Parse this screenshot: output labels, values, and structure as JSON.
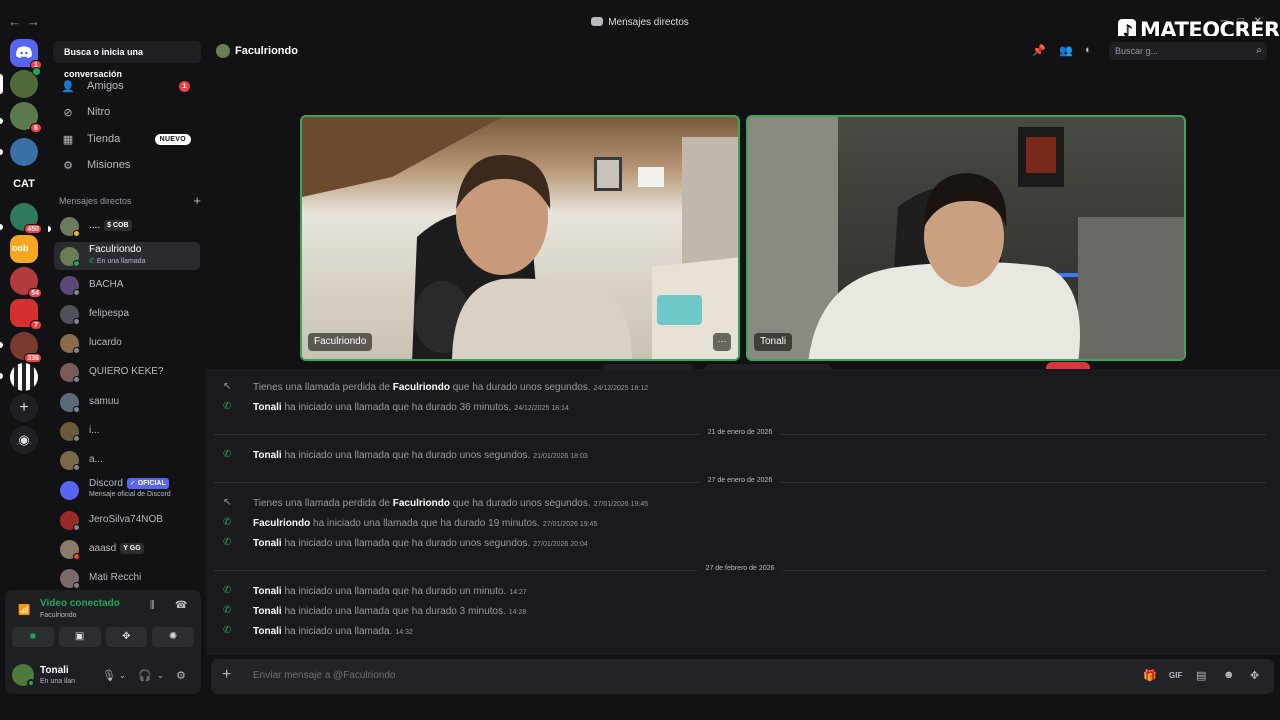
{
  "window": {
    "title": "Mensajes directos",
    "watermark": "MATEOCRERR"
  },
  "servers": {
    "badges": [
      "1",
      "6",
      "450",
      "54",
      "7",
      "336"
    ],
    "cat_label": "CAT"
  },
  "sidebar": {
    "search_label": "Busca o inicia una conversación",
    "nav": [
      {
        "label": "Amigos",
        "icon": "friends-icon",
        "count": "1"
      },
      {
        "label": "Nitro",
        "icon": "nitro-icon"
      },
      {
        "label": "Tienda",
        "icon": "shop-icon",
        "badge": "NUEVO"
      },
      {
        "label": "Misiones",
        "icon": "quests-icon"
      }
    ],
    "dm_header": "Mensajes directos",
    "dms": [
      {
        "name": "....",
        "tag": "COB"
      },
      {
        "name": "Faculriondo",
        "sub": "En una llamada"
      },
      {
        "name": "BACHA"
      },
      {
        "name": "felipespa"
      },
      {
        "name": "lucardo"
      },
      {
        "name": "QUIERO KEKE?"
      },
      {
        "name": "samuu"
      },
      {
        "name": "i..."
      },
      {
        "name": "a..."
      },
      {
        "name": "Discord",
        "tag": "OFICIAL",
        "sub": "Mensaje oficial de Discord"
      },
      {
        "name": "JeroSilva74NOB"
      },
      {
        "name": "aaasd",
        "tag": "GG"
      },
      {
        "name": "Mati Recchi"
      }
    ]
  },
  "voice": {
    "status": "Video conectado",
    "channel": "Faculriondo"
  },
  "user": {
    "name": "Tonali",
    "status": "En una llan"
  },
  "chat": {
    "recipient": "Faculriondo",
    "search_placeholder": "Buscar g...",
    "tiles": [
      "Faculriondo",
      "Tonali"
    ],
    "composer_placeholder": "Enviar mensaje a @Faculriondo",
    "log": [
      {
        "kind": "missed",
        "pre": "Tienes una llamada perdida de ",
        "who": "Faculriondo",
        "post": " que ha durado unos segundos.",
        "ts": "24/12/2025 18:12"
      },
      {
        "kind": "call",
        "who": "Tonali",
        "post": " ha iniciado una llamada que ha durado 36 minutos.",
        "ts": "24/12/2025 18:14"
      },
      {
        "kind": "divider",
        "text": "21 de enero de 2026"
      },
      {
        "kind": "call",
        "who": "Tonali",
        "post": " ha iniciado una llamada que ha durado unos segundos.",
        "ts": "21/01/2026 18:03"
      },
      {
        "kind": "divider",
        "text": "27 de enero de 2026"
      },
      {
        "kind": "missed",
        "pre": "Tienes una llamada perdida de ",
        "who": "Faculriondo",
        "post": " que ha durado unos segundos.",
        "ts": "27/01/2026 19:45"
      },
      {
        "kind": "call",
        "who": "Faculriondo",
        "post": " ha iniciado una llamada que ha durado 19 minutos.",
        "ts": "27/01/2026 19:45"
      },
      {
        "kind": "call",
        "who": "Tonali",
        "post": " ha iniciado una llamada que ha durado unos segundos.",
        "ts": "27/01/2026 20:04"
      },
      {
        "kind": "divider",
        "text": "27 de febrero de 2026"
      },
      {
        "kind": "call",
        "who": "Tonali",
        "post": " ha iniciado una llamada que ha durado un minuto.",
        "ts": "14:27"
      },
      {
        "kind": "call",
        "who": "Tonali",
        "post": " ha iniciado una llamada que ha durado 3 minutos.",
        "ts": "14:28"
      },
      {
        "kind": "call",
        "who": "Tonali",
        "post": " ha iniciado una llamada.",
        "ts": "14:32"
      }
    ]
  },
  "colors": {
    "accent": "#5865f2",
    "online": "#23a55a",
    "danger": "#da373c",
    "call_border": "#3ba55c"
  }
}
